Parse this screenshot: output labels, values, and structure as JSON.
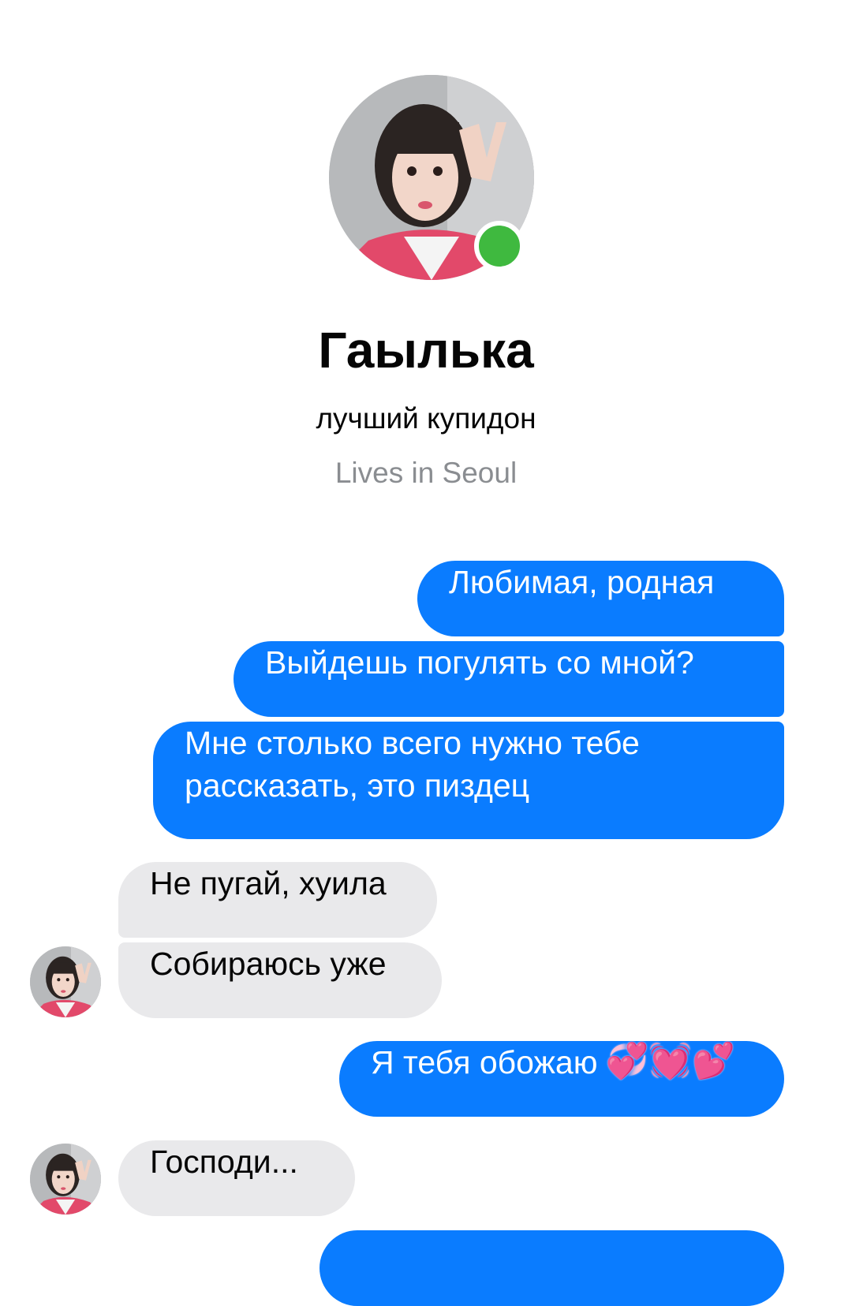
{
  "profile": {
    "name": "Гаылька",
    "bio": "лучший купидон",
    "location": "Lives in Seoul",
    "online": true
  },
  "colors": {
    "outgoing_bubble": "#0a7cff",
    "incoming_bubble": "#e9e9eb",
    "online_dot": "#3fb93f"
  },
  "messages": [
    {
      "direction": "outgoing",
      "text": "Любимая, родная"
    },
    {
      "direction": "outgoing",
      "text": "Выйдешь погулять со мной?"
    },
    {
      "direction": "outgoing",
      "text": "Мне столько всего нужно тебе рассказать, это пиздец"
    },
    {
      "direction": "incoming",
      "text": "Не пугай, хуила"
    },
    {
      "direction": "incoming",
      "text": "Собираюсь уже"
    },
    {
      "direction": "outgoing",
      "text": "Я тебя обожаю",
      "emoji": [
        "💞",
        "💓",
        "💕"
      ]
    },
    {
      "direction": "incoming",
      "text": "Господи..."
    },
    {
      "direction": "outgoing",
      "text": ""
    }
  ],
  "icons": {
    "contact_avatar": "contact-avatar",
    "online_indicator": "online-dot"
  }
}
